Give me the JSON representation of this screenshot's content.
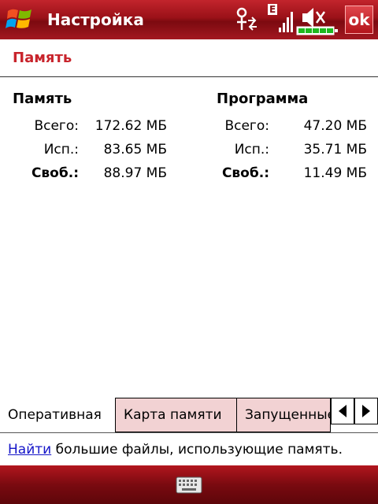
{
  "titlebar": {
    "title": "Настройка",
    "ok_label": "ok",
    "network_type": "E"
  },
  "page": {
    "title": "Память"
  },
  "columns": [
    {
      "header": "Память",
      "rows": [
        {
          "label": "Всего:",
          "value": "172.62 МБ",
          "bold": false
        },
        {
          "label": "Исп.:",
          "value": "83.65 МБ",
          "bold": false
        },
        {
          "label": "Своб.:",
          "value": "88.97 МБ",
          "bold": true
        }
      ]
    },
    {
      "header": "Программа",
      "rows": [
        {
          "label": "Всего:",
          "value": "47.20 МБ",
          "bold": false
        },
        {
          "label": "Исп.:",
          "value": "35.71 МБ",
          "bold": false
        },
        {
          "label": "Своб.:",
          "value": "11.49 МБ",
          "bold": true
        }
      ]
    }
  ],
  "tabs": [
    {
      "label": "Оперативная",
      "active": true
    },
    {
      "label": "Карта памяти",
      "active": false
    },
    {
      "label": "Запущенные",
      "active": false
    }
  ],
  "hint": {
    "link": "Найти",
    "text": " большие файлы, использующие память."
  },
  "colors": {
    "accent": "#c8242c",
    "tab_inactive": "#f2d2d3",
    "link": "#1414c8"
  }
}
